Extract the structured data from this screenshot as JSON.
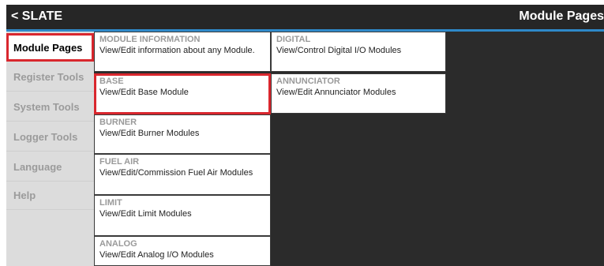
{
  "header": {
    "back_label": "< SLATE",
    "title": "Module Pages"
  },
  "colors": {
    "accent": "#2f89c9",
    "selection": "#d9272e",
    "header_bg": "#262626"
  },
  "sidebar": {
    "items": [
      {
        "label": "Module Pages",
        "active": true
      },
      {
        "label": "Register Tools",
        "active": false
      },
      {
        "label": "System Tools",
        "active": false
      },
      {
        "label": "Logger Tools",
        "active": false
      },
      {
        "label": "Language",
        "active": false
      },
      {
        "label": "Help",
        "active": false
      }
    ]
  },
  "tiles": {
    "module_information": {
      "heading": "MODULE INFORMATION",
      "desc": "View/Edit information about any Module."
    },
    "digital": {
      "heading": "DIGITAL",
      "desc": "View/Control Digital I/O Modules"
    },
    "base": {
      "heading": "BASE",
      "desc": "View/Edit Base Module"
    },
    "annunciator": {
      "heading": "ANNUNCIATOR",
      "desc": "View/Edit Annunciator Modules"
    },
    "burner": {
      "heading": "BURNER",
      "desc": "View/Edit Burner Modules"
    },
    "fuel_air": {
      "heading": "FUEL AIR",
      "desc": "View/Edit/Commission Fuel Air Modules"
    },
    "limit": {
      "heading": "LIMIT",
      "desc": "View/Edit Limit Modules"
    },
    "analog": {
      "heading": "ANALOG",
      "desc": "View/Edit Analog I/O Modules"
    }
  }
}
